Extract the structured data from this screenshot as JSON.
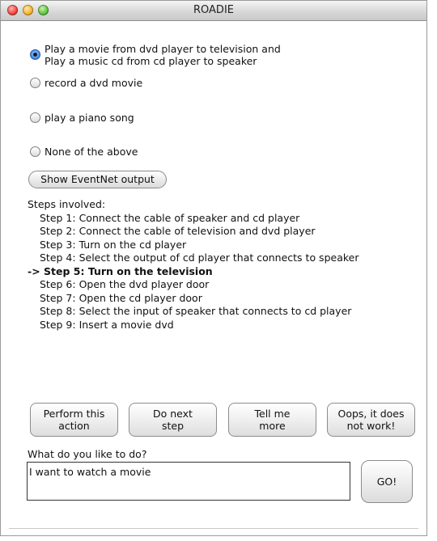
{
  "window": {
    "title": "ROADIE"
  },
  "options": [
    {
      "label": "Play a movie from dvd player to television and\nPlay a music cd from cd player to speaker",
      "checked": true
    },
    {
      "label": "record a dvd movie",
      "checked": false
    },
    {
      "label": "play a piano song",
      "checked": false
    },
    {
      "label": "None of the above",
      "checked": false
    }
  ],
  "show_eventnet_label": "Show EventNet output",
  "steps": {
    "heading": "Steps involved:",
    "items": [
      "Step 1: Connect the cable of speaker and cd player",
      "Step 2: Connect the cable of television and dvd player",
      "Step 3: Turn on the cd player",
      "Step 4: Select the output of cd player that connects to speaker",
      "-> Step 5: Turn on the television",
      "Step 6: Open the dvd player door",
      "Step 7: Open the cd player door",
      "Step 8: Select the input of speaker that connects to cd player",
      "Step 9: Insert a movie dvd"
    ]
  },
  "actions": {
    "perform": "Perform this\naction",
    "next": "Do next\nstep",
    "tell": "Tell me\nmore",
    "oops": "Oops, it does\nnot work!"
  },
  "prompt": {
    "label": "What do you like to do?",
    "value": "I want to watch a movie",
    "go_label": "GO!"
  }
}
